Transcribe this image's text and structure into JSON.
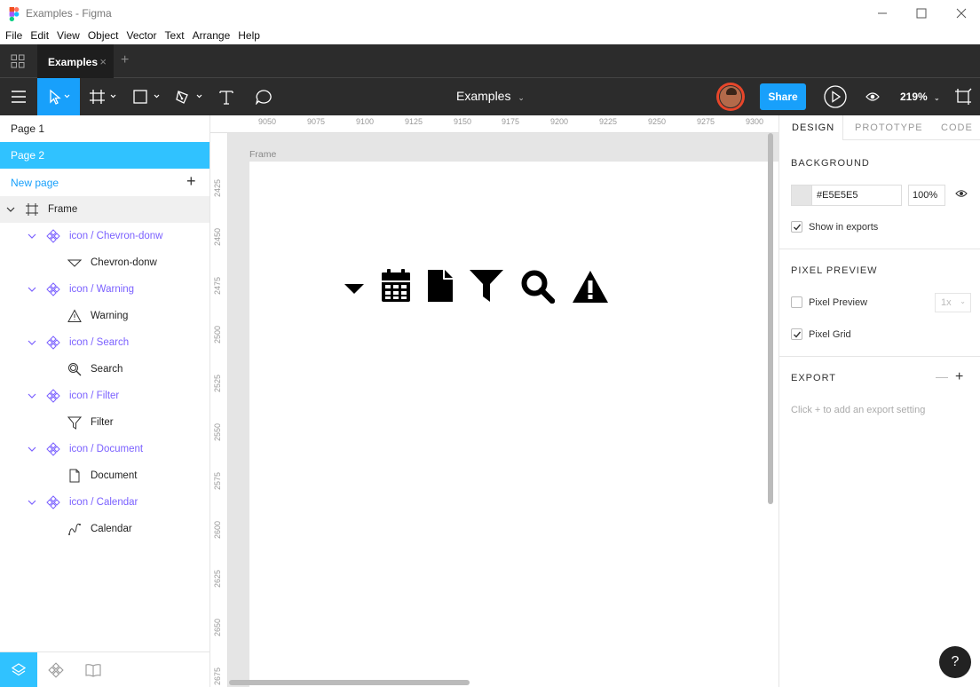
{
  "window": {
    "title": "Examples - Figma"
  },
  "menu": {
    "items": [
      "File",
      "Edit",
      "View",
      "Object",
      "Vector",
      "Text",
      "Arrange",
      "Help"
    ]
  },
  "tabs": {
    "active": "Examples",
    "close": "×",
    "add": "+"
  },
  "toolbar": {
    "doc_title": "Examples",
    "share_label": "Share",
    "zoom": "219%",
    "caret": "⌄"
  },
  "pages": {
    "items": [
      "Page 1",
      "Page 2"
    ],
    "selected": "Page 2",
    "new_page_label": "New page",
    "add": "+"
  },
  "layers": [
    {
      "label": "Frame",
      "type": "frame",
      "icon": "frame-icon"
    },
    {
      "label": "icon / Chevron-donw",
      "type": "component",
      "icon": "component-icon"
    },
    {
      "label": "Chevron-donw",
      "type": "vector",
      "icon": "chevron-vector-icon"
    },
    {
      "label": "icon / Warning",
      "type": "component",
      "icon": "component-icon"
    },
    {
      "label": "Warning",
      "type": "vector",
      "icon": "warning-vector-icon"
    },
    {
      "label": "icon / Search",
      "type": "component",
      "icon": "component-icon"
    },
    {
      "label": "Search",
      "type": "vector",
      "icon": "search-vector-icon"
    },
    {
      "label": "icon / Filter",
      "type": "component",
      "icon": "component-icon"
    },
    {
      "label": "Filter",
      "type": "vector",
      "icon": "filter-vector-icon"
    },
    {
      "label": "icon / Document",
      "type": "component",
      "icon": "component-icon"
    },
    {
      "label": "Document",
      "type": "vector",
      "icon": "document-vector-icon"
    },
    {
      "label": "icon / Calendar",
      "type": "component",
      "icon": "component-icon"
    },
    {
      "label": "Calendar",
      "type": "vector",
      "icon": "calendar-vector-icon"
    }
  ],
  "canvas": {
    "frame_label": "Frame",
    "ruler_x": [
      "9050",
      "9075",
      "9100",
      "9125",
      "9150",
      "9175",
      "9200",
      "9225",
      "9250",
      "9275",
      "9300"
    ],
    "ruler_y": [
      "2425",
      "2450",
      "2475",
      "2500",
      "2525",
      "2550",
      "2575",
      "2600",
      "2625",
      "2650",
      "2675"
    ],
    "icons": [
      "chevron-down-icon",
      "calendar-icon",
      "document-icon",
      "filter-icon",
      "search-icon",
      "warning-icon"
    ]
  },
  "design_panel": {
    "tabs": [
      "DESIGN",
      "PROTOTYPE",
      "CODE"
    ],
    "active_tab": "DESIGN",
    "background": {
      "title": "BACKGROUND",
      "hex": "#E5E5E5",
      "opacity": "100%",
      "show_in_exports_label": "Show in exports",
      "show_in_exports": true
    },
    "pixel_preview": {
      "title": "PIXEL PREVIEW",
      "pixel_preview_label": "Pixel Preview",
      "pixel_preview_checked": false,
      "scale": "1x",
      "pixel_grid_label": "Pixel Grid",
      "pixel_grid_checked": true
    },
    "export": {
      "title": "EXPORT",
      "minus": "—",
      "plus": "+",
      "hint": "Click + to add an export setting"
    }
  },
  "help_label": "?",
  "colors": {
    "accent": "#18a0fb",
    "selected_page": "#30c2ff",
    "component": "#7b61ff",
    "dark_bar": "#2c2c2c",
    "avatar_ring": "#e8462a"
  }
}
